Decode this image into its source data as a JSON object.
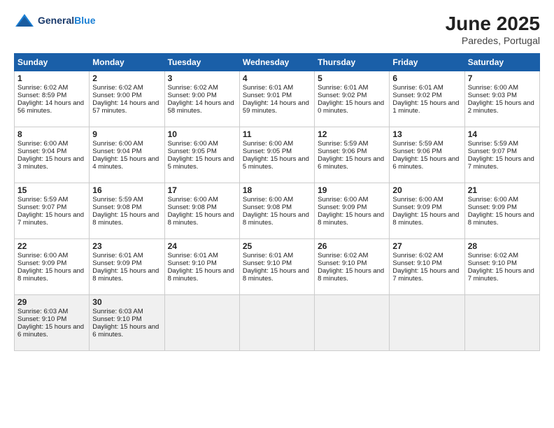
{
  "logo": {
    "text_general": "General",
    "text_blue": "Blue"
  },
  "title": "June 2025",
  "location": "Paredes, Portugal",
  "headers": [
    "Sunday",
    "Monday",
    "Tuesday",
    "Wednesday",
    "Thursday",
    "Friday",
    "Saturday"
  ],
  "weeks": [
    [
      {
        "day": "1",
        "sunrise": "6:02 AM",
        "sunset": "8:59 PM",
        "daylight": "14 hours and 56 minutes."
      },
      {
        "day": "2",
        "sunrise": "6:02 AM",
        "sunset": "9:00 PM",
        "daylight": "14 hours and 57 minutes."
      },
      {
        "day": "3",
        "sunrise": "6:02 AM",
        "sunset": "9:00 PM",
        "daylight": "14 hours and 58 minutes."
      },
      {
        "day": "4",
        "sunrise": "6:01 AM",
        "sunset": "9:01 PM",
        "daylight": "14 hours and 59 minutes."
      },
      {
        "day": "5",
        "sunrise": "6:01 AM",
        "sunset": "9:02 PM",
        "daylight": "15 hours and 0 minutes."
      },
      {
        "day": "6",
        "sunrise": "6:01 AM",
        "sunset": "9:02 PM",
        "daylight": "15 hours and 1 minute."
      },
      {
        "day": "7",
        "sunrise": "6:00 AM",
        "sunset": "9:03 PM",
        "daylight": "15 hours and 2 minutes."
      }
    ],
    [
      {
        "day": "8",
        "sunrise": "6:00 AM",
        "sunset": "9:04 PM",
        "daylight": "15 hours and 3 minutes."
      },
      {
        "day": "9",
        "sunrise": "6:00 AM",
        "sunset": "9:04 PM",
        "daylight": "15 hours and 4 minutes."
      },
      {
        "day": "10",
        "sunrise": "6:00 AM",
        "sunset": "9:05 PM",
        "daylight": "15 hours and 5 minutes."
      },
      {
        "day": "11",
        "sunrise": "6:00 AM",
        "sunset": "9:05 PM",
        "daylight": "15 hours and 5 minutes."
      },
      {
        "day": "12",
        "sunrise": "5:59 AM",
        "sunset": "9:06 PM",
        "daylight": "15 hours and 6 minutes."
      },
      {
        "day": "13",
        "sunrise": "5:59 AM",
        "sunset": "9:06 PM",
        "daylight": "15 hours and 6 minutes."
      },
      {
        "day": "14",
        "sunrise": "5:59 AM",
        "sunset": "9:07 PM",
        "daylight": "15 hours and 7 minutes."
      }
    ],
    [
      {
        "day": "15",
        "sunrise": "5:59 AM",
        "sunset": "9:07 PM",
        "daylight": "15 hours and 7 minutes."
      },
      {
        "day": "16",
        "sunrise": "5:59 AM",
        "sunset": "9:08 PM",
        "daylight": "15 hours and 8 minutes."
      },
      {
        "day": "17",
        "sunrise": "6:00 AM",
        "sunset": "9:08 PM",
        "daylight": "15 hours and 8 minutes."
      },
      {
        "day": "18",
        "sunrise": "6:00 AM",
        "sunset": "9:08 PM",
        "daylight": "15 hours and 8 minutes."
      },
      {
        "day": "19",
        "sunrise": "6:00 AM",
        "sunset": "9:09 PM",
        "daylight": "15 hours and 8 minutes."
      },
      {
        "day": "20",
        "sunrise": "6:00 AM",
        "sunset": "9:09 PM",
        "daylight": "15 hours and 8 minutes."
      },
      {
        "day": "21",
        "sunrise": "6:00 AM",
        "sunset": "9:09 PM",
        "daylight": "15 hours and 8 minutes."
      }
    ],
    [
      {
        "day": "22",
        "sunrise": "6:00 AM",
        "sunset": "9:09 PM",
        "daylight": "15 hours and 8 minutes."
      },
      {
        "day": "23",
        "sunrise": "6:01 AM",
        "sunset": "9:09 PM",
        "daylight": "15 hours and 8 minutes."
      },
      {
        "day": "24",
        "sunrise": "6:01 AM",
        "sunset": "9:10 PM",
        "daylight": "15 hours and 8 minutes."
      },
      {
        "day": "25",
        "sunrise": "6:01 AM",
        "sunset": "9:10 PM",
        "daylight": "15 hours and 8 minutes."
      },
      {
        "day": "26",
        "sunrise": "6:02 AM",
        "sunset": "9:10 PM",
        "daylight": "15 hours and 8 minutes."
      },
      {
        "day": "27",
        "sunrise": "6:02 AM",
        "sunset": "9:10 PM",
        "daylight": "15 hours and 7 minutes."
      },
      {
        "day": "28",
        "sunrise": "6:02 AM",
        "sunset": "9:10 PM",
        "daylight": "15 hours and 7 minutes."
      }
    ],
    [
      {
        "day": "29",
        "sunrise": "6:03 AM",
        "sunset": "9:10 PM",
        "daylight": "15 hours and 6 minutes."
      },
      {
        "day": "30",
        "sunrise": "6:03 AM",
        "sunset": "9:10 PM",
        "daylight": "15 hours and 6 minutes."
      },
      null,
      null,
      null,
      null,
      null
    ]
  ]
}
